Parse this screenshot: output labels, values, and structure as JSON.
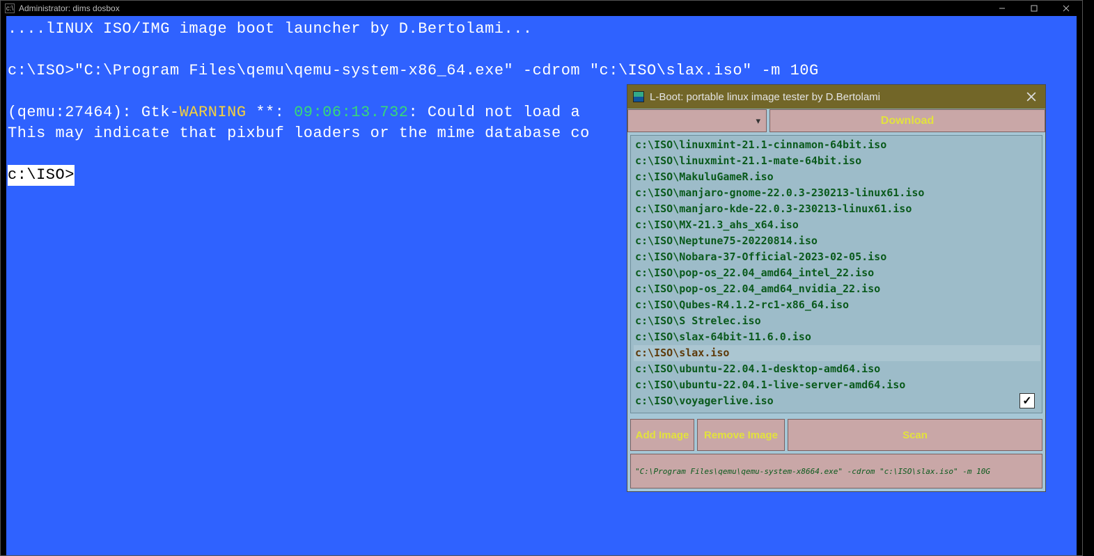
{
  "cmd": {
    "title": "Administrator:  dims dosbox",
    "banner": "....lINUX ISO/IMG image boot launcher by D.Bertolami...",
    "prompt1_prefix": "c:\\ISO>",
    "prompt1_cmd": "\"C:\\Program Files\\qemu\\qemu-system-x86_64.exe\" -cdrom \"c:\\ISO\\slax.iso\" -m 10G",
    "warn_prefix": "(qemu:27464): Gtk-",
    "warn_word": "WARNING",
    "warn_mid": " **: ",
    "warn_time": "09:06:13.732",
    "warn_rest": ": Could not load a ",
    "warn_line2": "This may indicate that pixbuf loaders or the mime database co",
    "prompt2": "c:\\ISO>"
  },
  "lboot": {
    "title": "L-Boot: portable linux image tester by D.Bertolami",
    "download_label": "Download",
    "dropdown_selected": "",
    "add_label": "Add Image",
    "remove_label": "Remove Image",
    "scan_label": "Scan",
    "checkbox_checked": true,
    "status": "\"C:\\Program Files\\qemu\\qemu-system-x8664.exe\" -cdrom \"c:\\ISO\\slax.iso\" -m 10G",
    "items": [
      {
        "path": "c:\\ISO\\linuxmint-21.1-cinnamon-64bit.iso"
      },
      {
        "path": "c:\\ISO\\linuxmint-21.1-mate-64bit.iso"
      },
      {
        "path": "c:\\ISO\\MakuluGameR.iso"
      },
      {
        "path": "c:\\ISO\\manjaro-gnome-22.0.3-230213-linux61.iso"
      },
      {
        "path": "c:\\ISO\\manjaro-kde-22.0.3-230213-linux61.iso"
      },
      {
        "path": "c:\\ISO\\MX-21.3_ahs_x64.iso"
      },
      {
        "path": "c:\\ISO\\Neptune75-20220814.iso"
      },
      {
        "path": "c:\\ISO\\Nobara-37-Official-2023-02-05.iso"
      },
      {
        "path": "c:\\ISO\\pop-os_22.04_amd64_intel_22.iso"
      },
      {
        "path": "c:\\ISO\\pop-os_22.04_amd64_nvidia_22.iso"
      },
      {
        "path": "c:\\ISO\\Qubes-R4.1.2-rc1-x86_64.iso"
      },
      {
        "path": "c:\\ISO\\S Strelec.iso"
      },
      {
        "path": "c:\\ISO\\slax-64bit-11.6.0.iso"
      },
      {
        "path": "c:\\ISO\\slax.iso",
        "selected": true
      },
      {
        "path": "c:\\ISO\\ubuntu-22.04.1-desktop-amd64.iso"
      },
      {
        "path": "c:\\ISO\\ubuntu-22.04.1-live-server-amd64.iso"
      },
      {
        "path": "c:\\ISO\\voyagerlive.iso"
      }
    ]
  }
}
